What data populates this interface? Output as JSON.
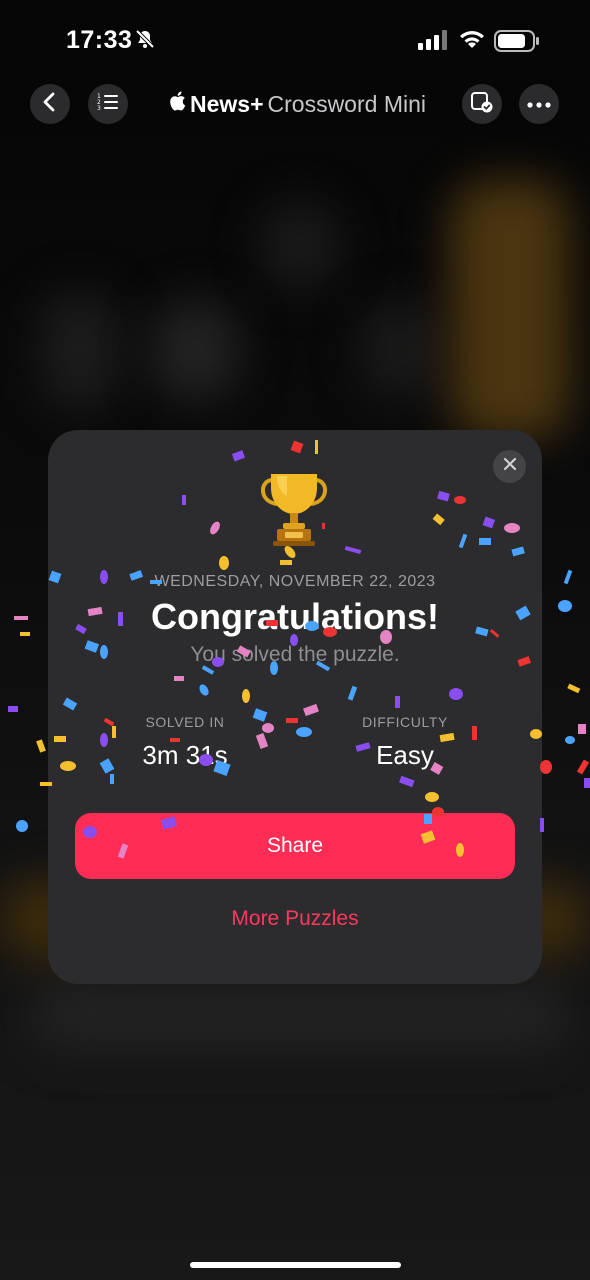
{
  "status_bar": {
    "time": "17:33"
  },
  "nav": {
    "brand": "News+",
    "subtitle": "Crossword Mini"
  },
  "modal": {
    "date": "WEDNESDAY, NOVEMBER 22, 2023",
    "headline": "Congratulations!",
    "subline": "You solved the puzzle.",
    "stats": [
      {
        "label": "SOLVED IN",
        "value": "3m 31s"
      },
      {
        "label": "DIFFICULTY",
        "value": "Easy"
      }
    ],
    "share_label": "Share",
    "more_label": "More Puzzles"
  },
  "colors": {
    "accent": "#ff2d55",
    "link": "#ff375f",
    "card": "#2c2c2e"
  },
  "icons": [
    "back-chevron-icon",
    "list-icon",
    "apple-logo-icon",
    "check-screen-icon",
    "more-icon",
    "close-icon",
    "trophy-icon",
    "bell-off-icon",
    "signal-icon",
    "wifi-icon",
    "battery-icon"
  ]
}
